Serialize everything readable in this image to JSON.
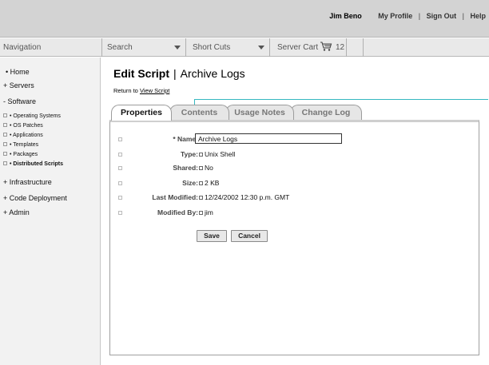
{
  "header": {
    "user_name": "Jim Beno",
    "links": [
      "My Profile",
      "Sign Out",
      "Help"
    ],
    "separator": "|"
  },
  "toolbar": {
    "navigation_label": "Navigation",
    "search_label": "Search",
    "shortcuts_label": "Short Cuts",
    "server_cart_label": "Server Cart",
    "server_cart_count": "12"
  },
  "sidebar": {
    "items": [
      "• Home",
      "+ Servers",
      "- Software"
    ],
    "software_sub": [
      "• Operating Systems",
      "• OS Patches",
      "• Applications",
      "• Templates",
      "• Packages",
      "• Distributed Scripts"
    ],
    "items_after": [
      "+ Infrastructure",
      "+ Code Deployment",
      "+ Admin"
    ]
  },
  "page": {
    "title": "Edit Script",
    "title_separator": "|",
    "subtitle": "Archive Logs",
    "return_prefix": "Return to",
    "return_link": "View Script"
  },
  "tabs": [
    "Properties",
    "Contents",
    "Usage Notes",
    "Change Log"
  ],
  "form": {
    "name_label": "* Name:",
    "name_value": "Archive Logs",
    "type_label": "Type:",
    "type_value": "Unix Shell",
    "shared_label": "Shared:",
    "shared_value": "No",
    "size_label": "Size:",
    "size_value": "2 KB",
    "last_modified_label": "Last Modified:",
    "last_modified_value": "12/24/2002 12:30 p.m. GMT",
    "modified_by_label": "Modified By:",
    "modified_by_value": "jim",
    "save_label": "Save",
    "cancel_label": "Cancel"
  },
  "colors": {
    "header_bg": "#d3d3d3",
    "toolbar_bg": "#e9e9e9",
    "sidebar_bg": "#f2f2f2",
    "callout": "#35b8c0"
  }
}
